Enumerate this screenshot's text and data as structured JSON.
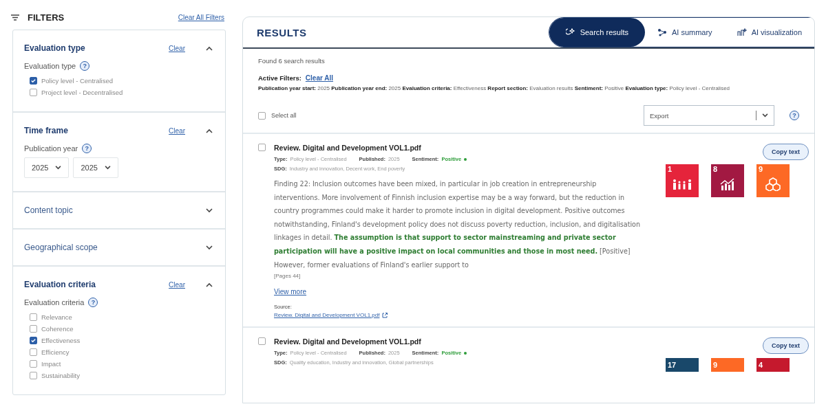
{
  "filters": {
    "title": "FILTERS",
    "clear_all": "Clear All Filters",
    "sections": [
      {
        "kind": "checkboxes",
        "title": "Evaluation type",
        "clear": "Clear",
        "expanded": true,
        "label": "Evaluation type",
        "help": "?",
        "options": [
          {
            "label": "Policy level - Centralised",
            "checked": true
          },
          {
            "label": "Project level - Decentralised",
            "checked": false
          }
        ]
      },
      {
        "kind": "years",
        "title": "Time frame",
        "clear": "Clear",
        "expanded": true,
        "label": "Publication year",
        "help": "?",
        "selects": [
          "2025",
          "2025"
        ]
      },
      {
        "title": "Content topic",
        "expanded": false
      },
      {
        "title": "Geographical scope",
        "expanded": false
      },
      {
        "kind": "checkboxes",
        "title": "Evaluation criteria",
        "clear": "Clear",
        "expanded": true,
        "label": "Evaluation criteria",
        "help": "?",
        "options": [
          {
            "label": "Relevance",
            "checked": false
          },
          {
            "label": "Coherence",
            "checked": false
          },
          {
            "label": "Effectiveness",
            "checked": true
          },
          {
            "label": "Efficiency",
            "checked": false
          },
          {
            "label": "Impact",
            "checked": false
          },
          {
            "label": "Sustainability",
            "checked": false
          }
        ]
      }
    ]
  },
  "results": {
    "title": "RESULTS",
    "tabs": [
      {
        "label": "Search results",
        "selected": true,
        "kind": "search"
      },
      {
        "label": "AI summary",
        "selected": false,
        "kind": "summary"
      },
      {
        "label": "AI visualization",
        "selected": false,
        "kind": "visual"
      }
    ],
    "count": "Found 6 search results",
    "active_filters": {
      "label": "Active Filters:",
      "clear": "Clear All",
      "text": "**Publication year start:** 2025 **Publication year end:** 2025 **Evaluation criteria:** Effectiveness **Report section:** Evaluation results **Sentiment:** Positive **Evaluation type:** Policy level - Centralised"
    },
    "select_all": {
      "label": "Select all",
      "checked": false
    },
    "export": {
      "value": "Export"
    },
    "help": "?",
    "cards": [
      {
        "title": "Review. Digital and Development VOL1.pdf",
        "checked": false,
        "type_label": "Type:",
        "type": "Policy level - Centralised",
        "published_label": "Published:",
        "published": "2025",
        "sentiment_label": "Sentiment:",
        "sentiment": "Positive",
        "sdg_label": "SDG:",
        "sdg": "Industry and innovation, Decent work, End poverty",
        "finding": "Finding 22: Inclusion outcomes have been mixed, in particular in job creation in entrepreneurship interventions. More involvement of Finnish inclusion expertise may be a way forward, but the reduction in country programmes could make it harder to promote inclusion in digital development. Positive outcomes notwithstanding, Finland's development policy does not discuss poverty reduction, inclusion, and digitalisation linkages in detail. **The assumption is that support to sector mainstreaming and private sector participation will have a positive impact on local communities and those in most need.** [Positive] However, former evaluations of Finland's earlier support to",
        "pages": "[Pages 44]",
        "view_more": "View more",
        "source_label": "Source:",
        "source": "Review. Digital and Development VOL1.pdf",
        "copy": "Copy text",
        "tiles": [
          {
            "number": "1",
            "color": "#e5243b",
            "kind": "people"
          },
          {
            "number": "8",
            "color": "#a21942",
            "kind": "growth"
          },
          {
            "number": "9",
            "color": "#fd6925",
            "kind": "cubes"
          }
        ]
      },
      {
        "title": "Review. Digital and Development VOL1.pdf",
        "checked": false,
        "type_label": "Type:",
        "type": "Policy level - Centralised",
        "published_label": "Published:",
        "published": "2025",
        "sentiment_label": "Sentiment:",
        "sentiment": "Positive",
        "sdg_label": "SDG:",
        "sdg": "Quality education, Industry and innovation, Global partnerships",
        "copy": "Copy text",
        "tiles": [
          {
            "number": "17",
            "color": "#19486a",
            "kind": "none"
          },
          {
            "number": "9",
            "color": "#fd6925",
            "kind": "none"
          },
          {
            "number": "4",
            "color": "#c5192d",
            "kind": "none"
          }
        ]
      }
    ]
  }
}
